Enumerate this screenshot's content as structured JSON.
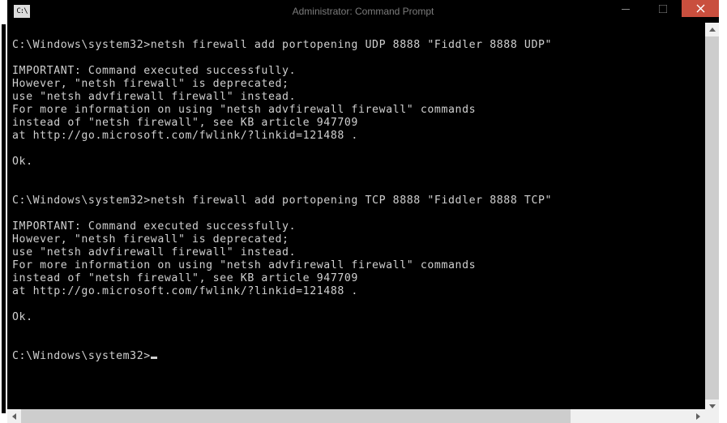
{
  "window": {
    "title": "Administrator: Command Prompt",
    "sys_icon_label": "C:\\"
  },
  "terminal": {
    "lines": [
      "",
      "C:\\Windows\\system32>netsh firewall add portopening UDP 8888 \"Fiddler 8888 UDP\"",
      "",
      "IMPORTANT: Command executed successfully.",
      "However, \"netsh firewall\" is deprecated;",
      "use \"netsh advfirewall firewall\" instead.",
      "For more information on using \"netsh advfirewall firewall\" commands",
      "instead of \"netsh firewall\", see KB article 947709",
      "at http://go.microsoft.com/fwlink/?linkid=121488 .",
      "",
      "Ok.",
      "",
      "",
      "C:\\Windows\\system32>netsh firewall add portopening TCP 8888 \"Fiddler 8888 TCP\"",
      "",
      "IMPORTANT: Command executed successfully.",
      "However, \"netsh firewall\" is deprecated;",
      "use \"netsh advfirewall firewall\" instead.",
      "For more information on using \"netsh advfirewall firewall\" commands",
      "instead of \"netsh firewall\", see KB article 947709",
      "at http://go.microsoft.com/fwlink/?linkid=121488 .",
      "",
      "Ok.",
      "",
      ""
    ],
    "prompt": "C:\\Windows\\system32>"
  }
}
